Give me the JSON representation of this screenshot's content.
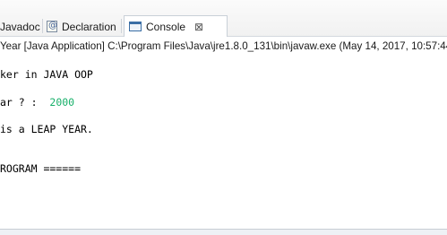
{
  "tabs": {
    "javadoc": "Javadoc",
    "declaration": "Declaration",
    "console": "Console",
    "console_close": "⊠"
  },
  "launch_info": "Year [Java Application] C:\\Program Files\\Java\\jre1.8.0_131\\bin\\javaw.exe (May 14, 2017, 10:57:44",
  "console": {
    "line1": "ker in JAVA OOP",
    "line2_prompt": "ar ? :  ",
    "line2_input": "2000",
    "line3": "is a LEAP YEAR.",
    "line4": "ROGRAM ======"
  },
  "colors": {
    "user_input": "#18b06a",
    "console_text": "#000000"
  },
  "icons": {
    "declaration": "declaration-icon",
    "console": "console-icon",
    "close": "close-icon"
  }
}
